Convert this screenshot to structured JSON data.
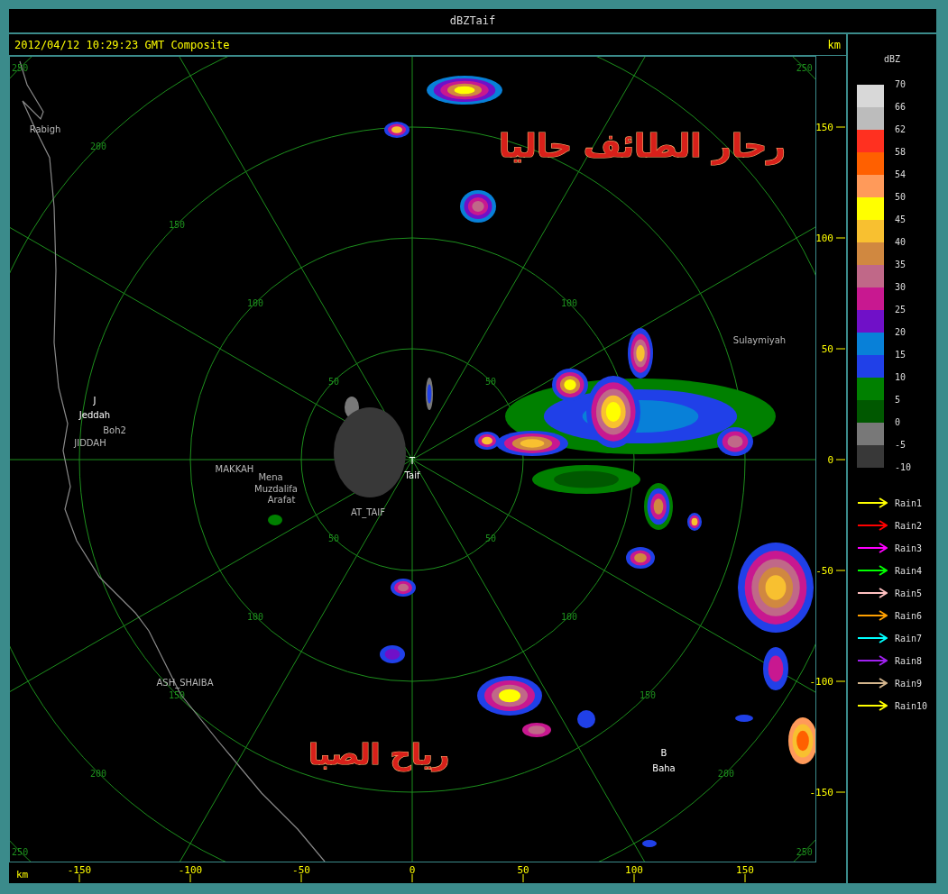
{
  "window": {
    "title": "dBZTaif"
  },
  "header": {
    "timestamp": "2012/04/12 10:29:23 GMT Composite",
    "unit": "km"
  },
  "plot": {
    "range_labels": [
      {
        "text": "250"
      },
      {
        "text": "200"
      },
      {
        "text": "150"
      },
      {
        "text": "100"
      },
      {
        "text": "50"
      },
      {
        "text": "50"
      },
      {
        "text": "100"
      },
      {
        "text": "250"
      },
      {
        "text": "50"
      },
      {
        "text": "100"
      },
      {
        "text": "150"
      },
      {
        "text": "200"
      },
      {
        "text": "250"
      },
      {
        "text": "50"
      },
      {
        "text": "100"
      },
      {
        "text": "150"
      },
      {
        "text": "200"
      },
      {
        "text": "250"
      }
    ],
    "places": [
      {
        "text": "Rabigh",
        "kind": "city"
      },
      {
        "text": "J",
        "kind": "radar"
      },
      {
        "text": "Jeddah",
        "kind": "radar"
      },
      {
        "text": "Boh2",
        "kind": "city"
      },
      {
        "text": "JIDDAH",
        "kind": "city"
      },
      {
        "text": "MAKKAH",
        "kind": "city"
      },
      {
        "text": "Mena",
        "kind": "city"
      },
      {
        "text": "Muzdalifa",
        "kind": "city"
      },
      {
        "text": "Arafat",
        "kind": "city"
      },
      {
        "text": "T",
        "kind": "radar"
      },
      {
        "text": "Taif",
        "kind": "radar"
      },
      {
        "text": "AT_TAIF",
        "kind": "city"
      },
      {
        "text": "Sulaymiyah",
        "kind": "city"
      },
      {
        "text": "ASH_SHAIBA",
        "kind": "city"
      },
      {
        "text": "B",
        "kind": "radar"
      },
      {
        "text": "Baha",
        "kind": "radar"
      }
    ],
    "annotations": [
      {
        "text": "رحار الطائف حاليا"
      },
      {
        "text": "رياح الصبا"
      }
    ]
  },
  "y_axis": {
    "ticks": [
      "150",
      "100",
      "50",
      "0",
      "-50",
      "-100",
      "-150"
    ]
  },
  "x_axis": {
    "unit": "km",
    "ticks": [
      "-150",
      "-100",
      "-50",
      "0",
      "50",
      "100",
      "150"
    ]
  },
  "legend": {
    "title": "dBZ",
    "labels": [
      "70",
      "66",
      "62",
      "58",
      "54",
      "50",
      "45",
      "40",
      "35",
      "30",
      "25",
      "20",
      "15",
      "10",
      "5",
      "0",
      "-5",
      "-10"
    ],
    "swatches": [
      {
        "color": "#d8d8d8"
      },
      {
        "color": "#bcbcbc"
      },
      {
        "color": "#ff3020"
      },
      {
        "color": "#ff6000"
      },
      {
        "color": "#ff9a5a"
      },
      {
        "color": "#ffff00"
      },
      {
        "color": "#f8c030"
      },
      {
        "color": "#d08840"
      },
      {
        "color": "#c06888"
      },
      {
        "color": "#c81890"
      },
      {
        "color": "#7010c8"
      },
      {
        "color": "#0880d8"
      },
      {
        "color": "#2040e8"
      },
      {
        "color": "#008000"
      },
      {
        "color": "#005800"
      },
      {
        "color": "#787878"
      },
      {
        "color": "#383838"
      }
    ],
    "tracks": [
      {
        "label": "Rain1",
        "color": "#ffff00"
      },
      {
        "label": "Rain2",
        "color": "#ff0000"
      },
      {
        "label": "Rain3",
        "color": "#ff00ff"
      },
      {
        "label": "Rain4",
        "color": "#00ff00"
      },
      {
        "label": "Rain5",
        "color": "#ffc0c0"
      },
      {
        "label": "Rain6",
        "color": "#ffa000"
      },
      {
        "label": "Rain7",
        "color": "#00ffff"
      },
      {
        "label": "Rain8",
        "color": "#a020f0"
      },
      {
        "label": "Rain9",
        "color": "#d2b48c"
      },
      {
        "label": "Rain10",
        "color": "#ffff00"
      }
    ]
  }
}
